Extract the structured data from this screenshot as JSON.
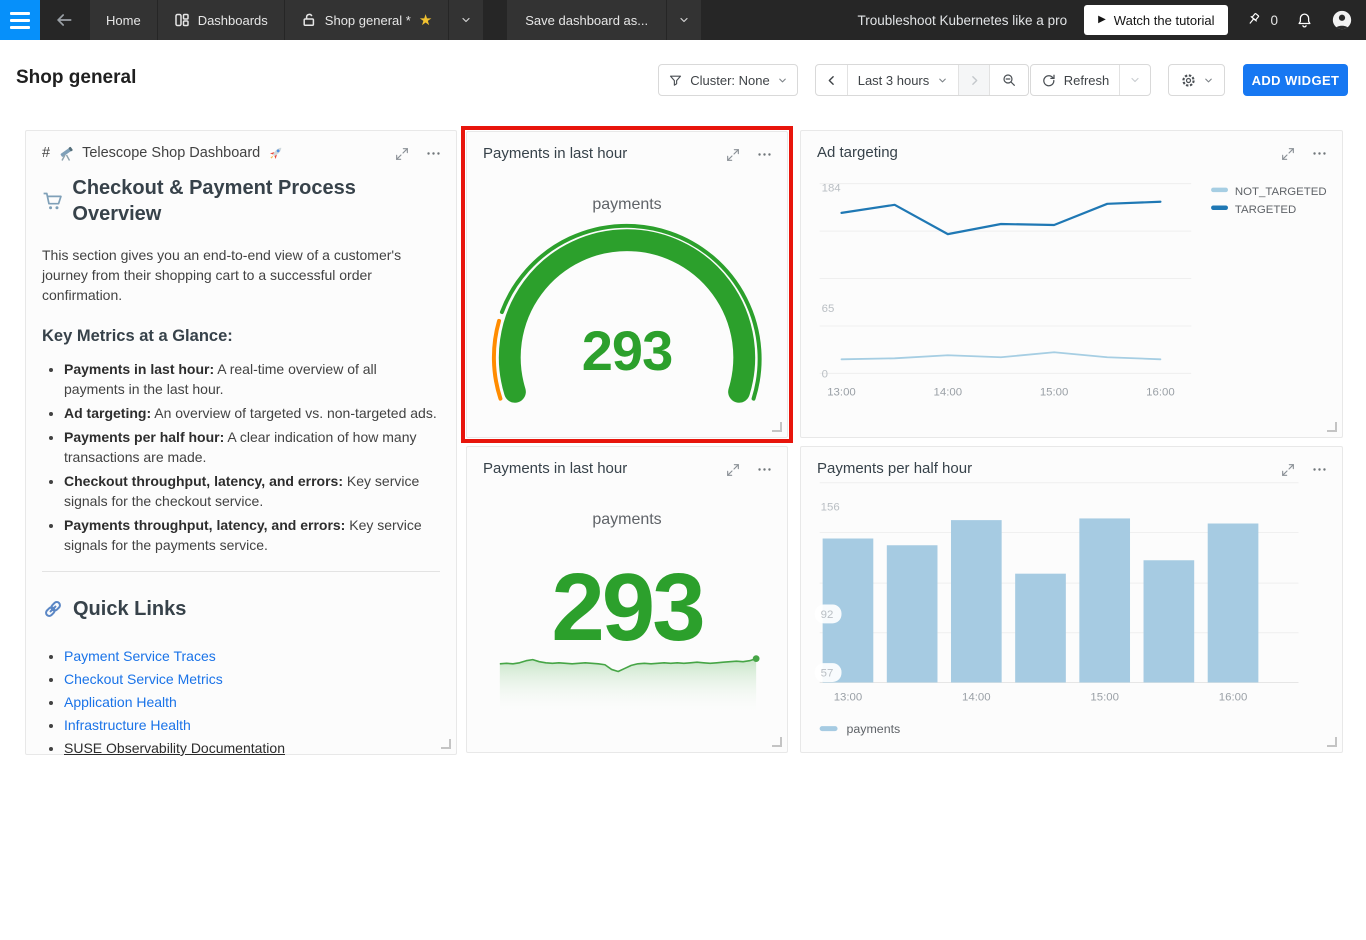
{
  "colors": {
    "accent_blue": "#1778f2",
    "menu_blue": "#0690fa",
    "star_gold": "#f2c230",
    "link_blue": "#1a73e8",
    "annotation_red": "#e8150c",
    "value_green": "#2ca02c"
  },
  "topbar": {
    "tabs": [
      {
        "label": "Home"
      },
      {
        "label": "Dashboards"
      },
      {
        "label": "Shop general *"
      }
    ],
    "save_button": "Save dashboard as...",
    "promo_text": "Troubleshoot Kubernetes like a pro",
    "tutorial_button": "Watch the tutorial",
    "play_glyph": "▶",
    "pin_count": "0"
  },
  "header": {
    "title": "Shop general",
    "cluster_label": "Cluster: None",
    "time_range": "Last 3 hours",
    "refresh_label": "Refresh",
    "add_widget": "ADD WIDGET"
  },
  "markdown_widget": {
    "header_prefix": "#",
    "header_title": "Telescope Shop Dashboard",
    "header_icons": [
      "telescope-emoji",
      "rocket-emoji"
    ],
    "h1": "Checkout & Payment Process Overview",
    "h1_icon": "shopping-cart-emoji",
    "intro": "This section gives you an end-to-end view of a customer's journey from their shopping cart to a successful order confirmation.",
    "h2": "Key Metrics at a Glance:",
    "metrics": [
      {
        "term": "Payments in last hour:",
        "desc": "A real-time overview of all payments in the last hour."
      },
      {
        "term": "Ad targeting:",
        "desc": "An overview of targeted vs. non-targeted ads."
      },
      {
        "term": "Payments per half hour:",
        "desc": "A clear indication of how many transactions are made."
      },
      {
        "term": "Checkout throughput, latency, and errors:",
        "desc": "Key service signals for the checkout service."
      },
      {
        "term": "Payments throughput, latency, and errors:",
        "desc": "Key service signals for the payments service."
      }
    ],
    "links_heading": "Quick Links",
    "links_icon": "link-emoji",
    "links": [
      {
        "label": "Payment Service Traces",
        "style": "link"
      },
      {
        "label": "Checkout Service Metrics",
        "style": "link"
      },
      {
        "label": "Application Health",
        "style": "link"
      },
      {
        "label": "Infrastructure Health",
        "style": "link"
      },
      {
        "label": "SUSE Observability Documentation",
        "style": "underline-dark"
      }
    ]
  },
  "chart_data": [
    {
      "type": "gauge",
      "title": "Payments in last hour",
      "metric_label": "payments",
      "value": 293,
      "value_color": "#2ca02c",
      "arc": {
        "start_deg": -107,
        "end_deg": 107,
        "radius": 118,
        "width": 22,
        "color": "#2ca02c"
      },
      "axis_ring": {
        "radius": 134,
        "width": 4,
        "bands": [
          {
            "from_deg": -108,
            "to_deg": -74,
            "color": "#ff8c00"
          },
          {
            "from_deg": -70,
            "to_deg": 108,
            "color": "#2ca02c"
          }
        ]
      }
    },
    {
      "type": "line",
      "title": "Ad targeting",
      "x": [
        "13:00",
        "13:30",
        "14:00",
        "14:30",
        "15:00",
        "15:30",
        "16:00"
      ],
      "x_tick_labels": [
        "13:00",
        "14:00",
        "15:00",
        "16:00"
      ],
      "series": [
        {
          "name": "NOT_TARGETED",
          "color": "#a6cee3",
          "values": [
            14,
            15,
            18,
            16,
            21,
            16,
            14
          ]
        },
        {
          "name": "TARGETED",
          "color": "#1f78b4",
          "values": [
            159,
            167,
            138,
            148,
            147,
            168,
            170
          ]
        }
      ],
      "y_ticks": [
        184,
        65,
        0
      ],
      "ylim": [
        0,
        191
      ],
      "grid": true,
      "legend_position": "right"
    },
    {
      "type": "single_value",
      "title": "Payments in last hour",
      "metric_label": "payments",
      "value": 293,
      "value_color": "#2ca02c",
      "sparkline": {
        "color": "#46a546",
        "values": [
          283,
          284,
          283,
          285,
          289,
          291,
          287,
          285,
          284,
          285,
          284,
          283,
          284,
          285,
          284,
          283,
          281,
          272,
          268,
          274,
          280,
          283,
          284,
          283,
          284,
          285,
          284,
          285,
          284,
          285,
          286,
          285,
          284,
          285,
          286,
          287,
          288,
          287,
          289,
          293
        ]
      }
    },
    {
      "type": "bar",
      "title": "Payments per half hour",
      "x": [
        "13:00",
        "13:30",
        "14:00",
        "14:30",
        "15:00",
        "15:30",
        "16:00"
      ],
      "x_tick_labels": [
        "13:00",
        "14:00",
        "15:00",
        "16:00"
      ],
      "values": [
        137,
        133,
        148,
        116,
        149,
        124,
        146
      ],
      "bar_color": "#a6cbe2",
      "y_ticks": [
        156,
        92,
        57
      ],
      "y_tick_pills": [
        false,
        true,
        true
      ],
      "ylim": [
        51,
        160
      ],
      "legend": [
        {
          "name": "payments",
          "color": "#a6cbe2"
        }
      ]
    }
  ]
}
